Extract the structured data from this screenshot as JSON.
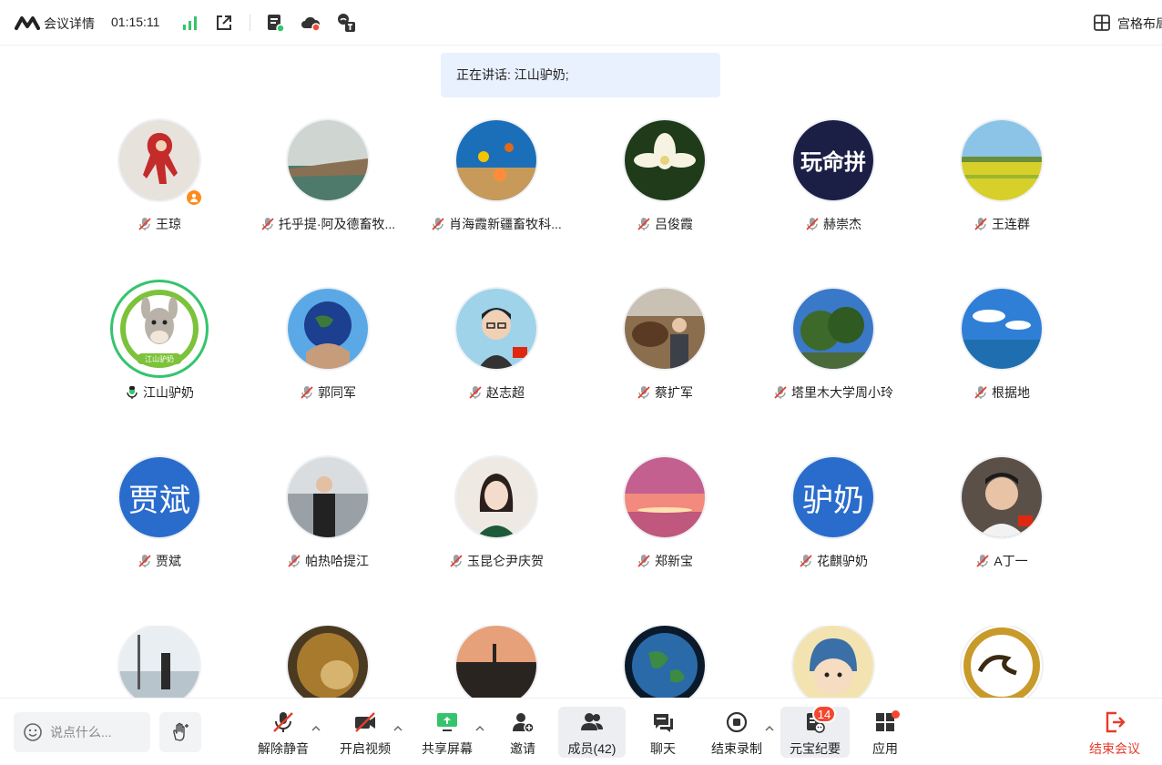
{
  "topbar": {
    "title": "会议详情",
    "time": "01:15:11",
    "layout_label": "宫格布局"
  },
  "speaking_banner": "正在讲话: 江山驴奶;",
  "participants": [
    {
      "name": "王琼",
      "mic": "muted",
      "role": "host",
      "avatar": "image"
    },
    {
      "name": "托乎提·阿及德畜牧...",
      "mic": "muted",
      "avatar": "image"
    },
    {
      "name": "肖海霞新疆畜牧科...",
      "mic": "muted",
      "avatar": "image"
    },
    {
      "name": "吕俊霞",
      "mic": "muted",
      "avatar": "image"
    },
    {
      "name": "赫崇杰",
      "mic": "muted",
      "avatar": "image",
      "avatar_text": "玩命拼"
    },
    {
      "name": "王连群",
      "mic": "muted",
      "avatar": "image"
    },
    {
      "name": "江山驴奶",
      "mic": "speaking",
      "avatar": "image",
      "logo_text": "江山驴奶"
    },
    {
      "name": "郭同军",
      "mic": "muted",
      "avatar": "image"
    },
    {
      "name": "赵志超",
      "mic": "muted",
      "avatar": "image"
    },
    {
      "name": "蔡扩军",
      "mic": "muted",
      "avatar": "image"
    },
    {
      "name": "塔里木大学周小玲",
      "mic": "muted",
      "avatar": "image"
    },
    {
      "name": "根据地",
      "mic": "muted",
      "avatar": "image"
    },
    {
      "name": "贾斌",
      "mic": "muted",
      "avatar": "text",
      "avatar_text": "贾斌",
      "avatar_color": "#2a6ccc"
    },
    {
      "name": "帕热哈提江",
      "mic": "muted",
      "avatar": "image"
    },
    {
      "name": "玉昆仑尹庆贺",
      "mic": "muted",
      "avatar": "image"
    },
    {
      "name": "郑新宝",
      "mic": "muted",
      "avatar": "image"
    },
    {
      "name": "花麒驴奶",
      "mic": "muted",
      "avatar": "text",
      "avatar_text": "驴奶",
      "avatar_color": "#2a6ccc"
    },
    {
      "name": "A丁一",
      "mic": "muted",
      "avatar": "image"
    }
  ],
  "bottombar": {
    "chat_placeholder": "说点什么...",
    "unmute": "解除静音",
    "start_video": "开启视频",
    "share_screen": "共享屏幕",
    "invite": "邀请",
    "members": "成员(42)",
    "chat": "聊天",
    "end_recording": "结束录制",
    "yuanbao": "元宝纪要",
    "yuanbao_badge": "14",
    "apps": "应用",
    "end_meeting": "结束会议"
  },
  "colors": {
    "accent_green": "#35c46d",
    "danger_red": "#e53c2c",
    "badge_red": "#f4472f",
    "text_avatar_blue": "#2a6ccc"
  }
}
